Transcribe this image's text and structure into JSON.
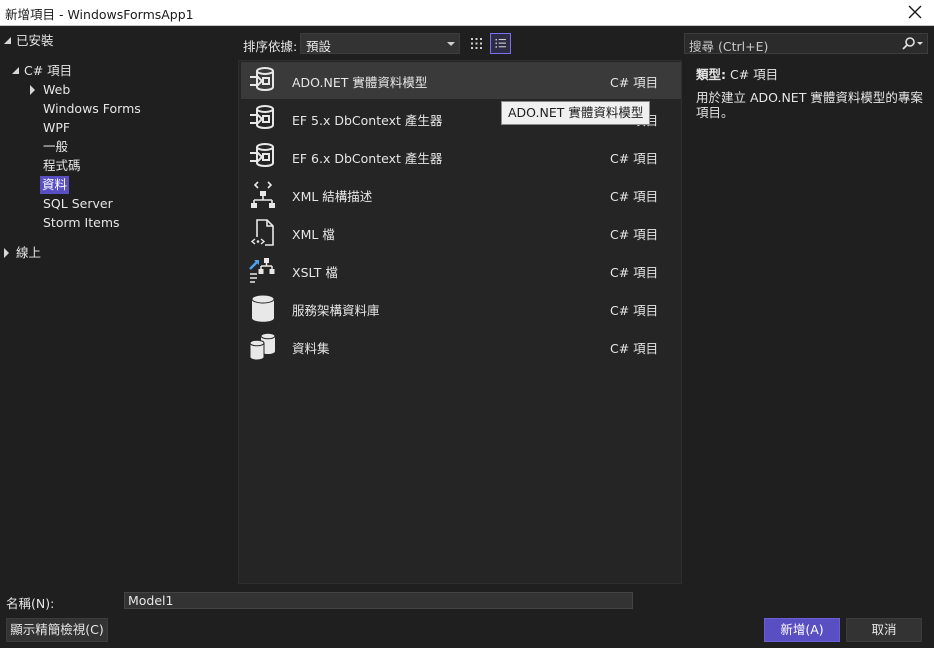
{
  "window": {
    "title": "新增項目 - WindowsFormsApp1"
  },
  "tree": {
    "installed": "已安裝",
    "csharp": "C# 項目",
    "items": [
      "Web",
      "Windows Forms",
      "WPF",
      "一般",
      "程式碼",
      "資料",
      "SQL Server",
      "Storm Items"
    ],
    "online": "線上"
  },
  "toolbar": {
    "sort_label": "排序依據:",
    "sort_value": "預設",
    "search_placeholder": "搜尋 (Ctrl+E)"
  },
  "templates": [
    {
      "name": "ADO.NET 實體資料模型",
      "lang": "C# 項目",
      "icon": "entity-model-icon"
    },
    {
      "name": "EF 5.x DbContext 產生器",
      "lang": "C# 項目",
      "icon": "entity-model-icon"
    },
    {
      "name": "EF 6.x DbContext 產生器",
      "lang": "C# 項目",
      "icon": "entity-model-icon"
    },
    {
      "name": "XML 結構描述",
      "lang": "C# 項目",
      "icon": "xml-schema-icon"
    },
    {
      "name": "XML 檔",
      "lang": "C# 項目",
      "icon": "xml-file-icon"
    },
    {
      "name": "XSLT 檔",
      "lang": "C# 項目",
      "icon": "xslt-file-icon"
    },
    {
      "name": "服務架構資料庫",
      "lang": "C# 項目",
      "icon": "database-icon"
    },
    {
      "name": "資料集",
      "lang": "C# 項目",
      "icon": "dataset-icon"
    }
  ],
  "tooltip": "ADO.NET 實體資料模型",
  "details": {
    "type_label": "類型:",
    "type_value": "C# 項目",
    "description": "用於建立 ADO.NET 實體資料模型的專案項目。"
  },
  "footer": {
    "name_label": "名稱(N):",
    "name_value": "Model1",
    "compact_view": "顯示精簡檢視(C)",
    "add": "新增(A)",
    "cancel": "取消"
  },
  "colors": {
    "accent": "#5a4fc2",
    "background": "#1f1f1f",
    "list_background": "#252526"
  }
}
